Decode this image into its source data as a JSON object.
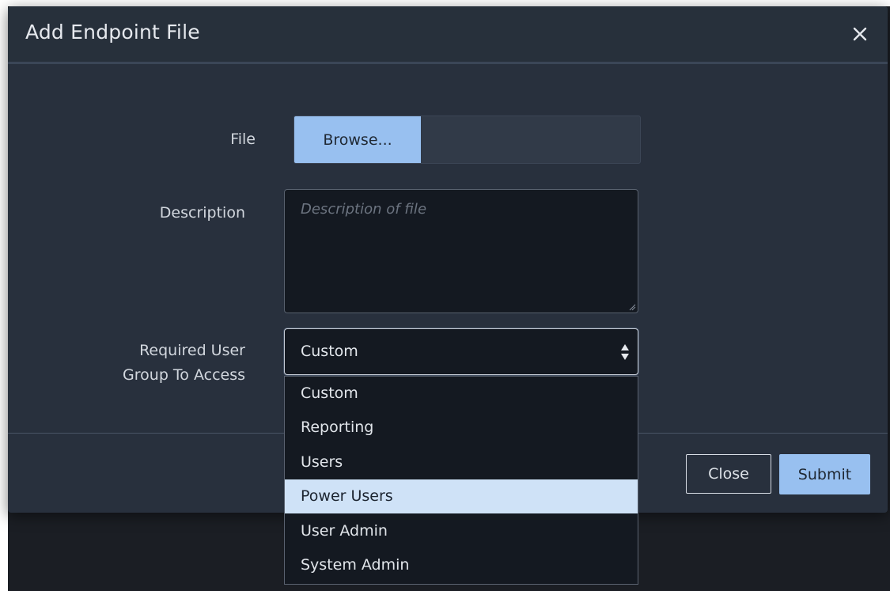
{
  "dialog": {
    "title": "Add Endpoint File"
  },
  "form": {
    "file_label": "File",
    "browse_label": "Browse...",
    "description_label": "Description",
    "description_placeholder": "Description of file",
    "description_value": "",
    "group_label_line1": "Required User",
    "group_label_line2": "Group To Access",
    "group_selected": "Custom"
  },
  "dropdown": {
    "options": [
      "Custom",
      "Reporting",
      "Users",
      "Power Users",
      "User Admin",
      "System Admin"
    ],
    "highlighted": "Power Users"
  },
  "footer": {
    "close_label": "Close",
    "submit_label": "Submit"
  },
  "colors": {
    "accent": "#98c0f0",
    "modal_bg": "#28303d",
    "field_bg": "#141921",
    "highlight": "#cfe2f7"
  },
  "icons": {
    "close": "close-icon",
    "select_arrows": "sort-arrows-icon",
    "resize": "resize-grip-icon"
  }
}
